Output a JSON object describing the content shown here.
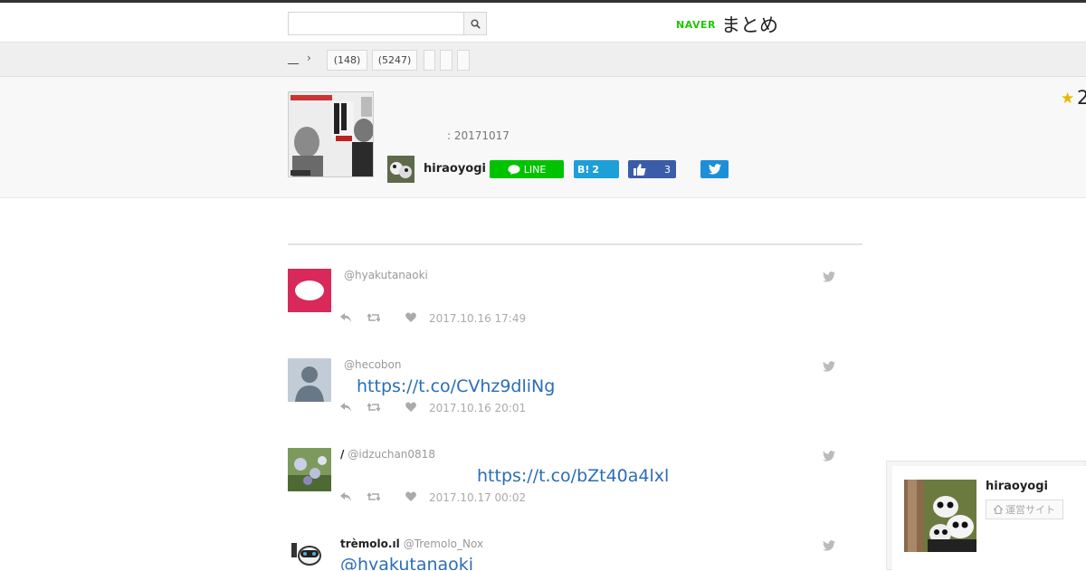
{
  "header": {
    "search_placeholder": "",
    "logo_brand": "NAVER",
    "logo_title": "まとめ"
  },
  "breadcrumb": {
    "home": "__",
    "tags": [
      "(148)",
      "(5247)",
      "",
      "",
      ""
    ]
  },
  "article": {
    "favorites": "2",
    "date": ": 20171017",
    "author": "hiraoyogi",
    "line_label": "LINE",
    "hatena_count": "2",
    "facebook_count": "3"
  },
  "tweets": [
    {
      "name": "",
      "handle": "@hyakutanaoki",
      "link": "",
      "time": "2017.10.16 17:49"
    },
    {
      "name": "",
      "handle": "@hecobon",
      "link": "https://t.co/CVhz9dliNg",
      "time": "2017.10.16 20:01"
    },
    {
      "name": "/",
      "handle": "@idzuchan0818",
      "link": "https://t.co/bZt40a4lxl",
      "time": "2017.10.17 00:02"
    },
    {
      "name": "trèmolo.ıl",
      "handle": "@Tremolo_Nox",
      "link": "@hyakutanaoki",
      "time": ""
    }
  ],
  "author_panel": {
    "name": "hiraoyogi",
    "site_label": "運営サイト"
  },
  "colors": {
    "naver_green": "#1ec800",
    "line_green": "#00c300",
    "hatena_blue": "#1d9fd8",
    "facebook_blue": "#3b5ca8",
    "twitter_blue": "#1d8fd8",
    "link_blue": "#2a6db8"
  }
}
